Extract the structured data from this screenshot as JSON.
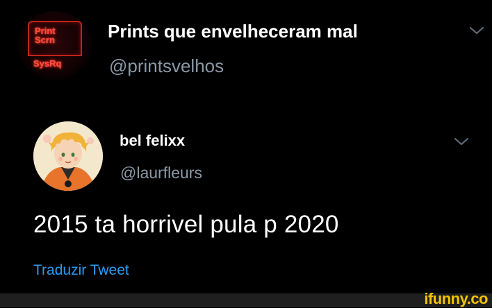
{
  "outer_tweet": {
    "display_name": "Prints que envelheceram mal",
    "handle": "@printsvelhos",
    "avatar": {
      "key_top": "Print\nScrn",
      "key_line1": "Print",
      "key_line2": "Scrn",
      "key_bottom": "SysRq"
    }
  },
  "inner_tweet": {
    "display_name": "bel felixx",
    "handle": "@laurfleurs",
    "text": "2015 ta horrivel pula p 2020",
    "translate_label": "Traduzir Tweet"
  },
  "watermark": "ifunny.co",
  "colors": {
    "background": "#000000",
    "secondary_text": "#8b98a5",
    "link": "#2b9bf0",
    "neon_red": "#ff4a3d",
    "watermark": "#f5c400"
  },
  "icons": {
    "menu": "chevron-down-icon"
  }
}
